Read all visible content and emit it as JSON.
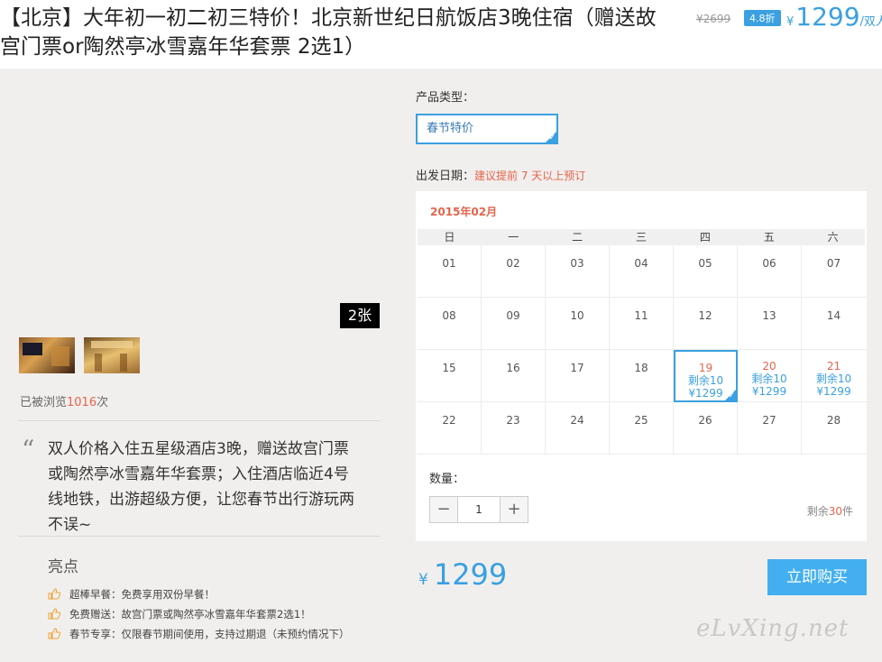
{
  "header": {
    "title": "【北京】大年初一初二初三特价！北京新世纪日航饭店3晚住宿（赠送故宫门票or陶然亭冰雪嘉年华套票 2选1）",
    "orig_price": "¥2699",
    "discount": "4.8折",
    "yen": "¥",
    "price": "1299",
    "unit": "/双人"
  },
  "gallery": {
    "count_label": "2张",
    "viewed_prefix": "已被浏览",
    "viewed_count": "1016",
    "viewed_suffix": "次"
  },
  "description": {
    "text": "双人价格入住五星级酒店3晚，赠送故宫门票或陶然亭冰雪嘉年华套票；入住酒店临近4号线地铁，出游超级方便，让您春节出行游玩两不误~"
  },
  "highlights": {
    "title": "亮点",
    "items": [
      "超棒早餐：免费享用双份早餐！",
      "免费赠送：故宫门票或陶然亭冰雪嘉年华套票2选1！",
      "春节专享：仅限春节期间使用，支持过期退（未预约情况下）"
    ]
  },
  "booking": {
    "product_type_label": "产品类型：",
    "product_type_value": "春节特价",
    "date_label": "出发日期：",
    "date_hint": "建议提前 7 天以上预订",
    "month": "2015年02月",
    "weekdays": [
      "日",
      "一",
      "二",
      "三",
      "四",
      "五",
      "六"
    ],
    "weeks": [
      [
        {
          "d": "01"
        },
        {
          "d": "02"
        },
        {
          "d": "03"
        },
        {
          "d": "04"
        },
        {
          "d": "05"
        },
        {
          "d": "06"
        },
        {
          "d": "07"
        }
      ],
      [
        {
          "d": "08"
        },
        {
          "d": "09"
        },
        {
          "d": "10"
        },
        {
          "d": "11"
        },
        {
          "d": "12"
        },
        {
          "d": "13"
        },
        {
          "d": "14"
        }
      ],
      [
        {
          "d": "15"
        },
        {
          "d": "16"
        },
        {
          "d": "17"
        },
        {
          "d": "18"
        },
        {
          "d": "19",
          "stock": "剩余10",
          "price": "¥1299",
          "selected": true
        },
        {
          "d": "20",
          "stock": "剩余10",
          "price": "¥1299"
        },
        {
          "d": "21",
          "stock": "剩余10",
          "price": "¥1299"
        }
      ],
      [
        {
          "d": "22"
        },
        {
          "d": "23"
        },
        {
          "d": "24"
        },
        {
          "d": "25"
        },
        {
          "d": "26"
        },
        {
          "d": "27"
        },
        {
          "d": "28"
        }
      ]
    ],
    "qty_label": "数量：",
    "qty_value": "1",
    "minus": "−",
    "plus": "+",
    "remain_prefix": "剩余",
    "remain_count": "30",
    "remain_suffix": "件",
    "total_yen": "¥",
    "total_price": "1299",
    "buy_label": "立即购买"
  },
  "watermark": "eLvXing.net",
  "colors": {
    "accent": "#3aa0e0",
    "highlight": "#e4644c",
    "button": "#43aff0"
  }
}
